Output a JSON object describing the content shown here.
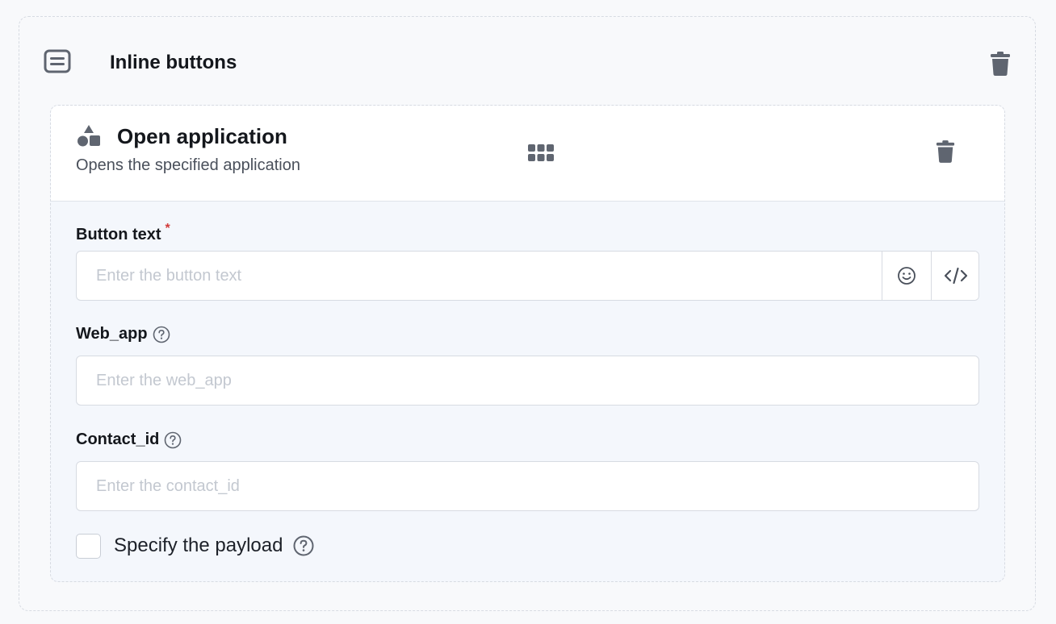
{
  "section": {
    "title": "Inline buttons",
    "icon": "list-box-icon",
    "delete_icon": "trash-icon"
  },
  "button_card": {
    "title": "Open application",
    "subtitle": "Opens the specified application",
    "icon": "shapes-icon",
    "drag_icon": "grid-dots-icon",
    "delete_icon": "trash-icon",
    "fields": {
      "button_text": {
        "label": "Button text",
        "required_mark": "*",
        "value": "",
        "placeholder": "Enter the button text",
        "emoji_icon": "smiley-icon",
        "code_icon": "code-icon"
      },
      "web_app": {
        "label": "Web_app",
        "value": "",
        "placeholder": "Enter the web_app"
      },
      "contact_id": {
        "label": "Contact_id",
        "value": "",
        "placeholder": "Enter the contact_id"
      }
    },
    "payload": {
      "label": "Specify the payload",
      "checked": false
    }
  },
  "colors": {
    "page_bg": "#f8f9fb",
    "card_bg": "#f4f7fc",
    "icon": "#5f6570",
    "required": "#d23b3b",
    "placeholder": "#c3c8d0"
  }
}
